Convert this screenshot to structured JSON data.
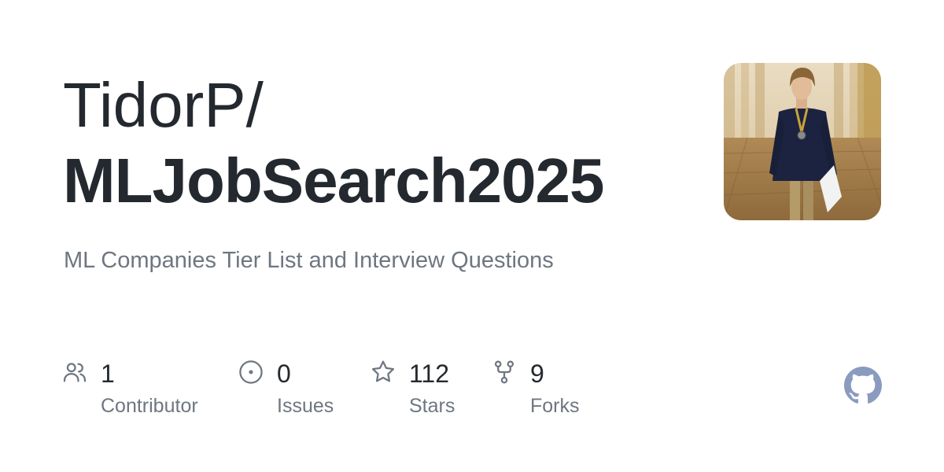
{
  "repo": {
    "owner": "TidorP/",
    "name": "MLJobSearch2025",
    "description": "ML Companies Tier List and Interview Questions"
  },
  "avatar": {
    "icon": "user-avatar-photo"
  },
  "stats": {
    "contributors": {
      "value": "1",
      "label": "Contributor",
      "icon": "people-icon"
    },
    "issues": {
      "value": "0",
      "label": "Issues",
      "icon": "issue-opened-icon"
    },
    "stars": {
      "value": "112",
      "label": "Stars",
      "icon": "star-icon"
    },
    "forks": {
      "value": "9",
      "label": "Forks",
      "icon": "repo-forked-icon"
    }
  },
  "brand": {
    "logo": "github-logo-icon",
    "logo_color": "#8b9bbf"
  },
  "colors": {
    "title": "#24292f",
    "muted": "#6e7681",
    "background": "#ffffff"
  }
}
